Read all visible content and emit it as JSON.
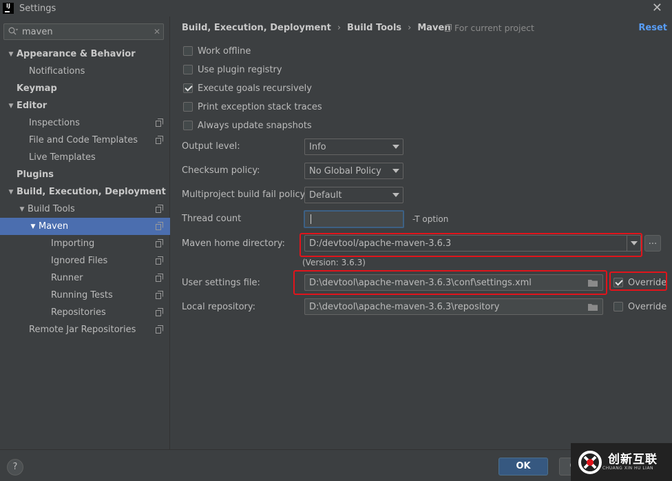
{
  "window": {
    "title": "Settings",
    "close_glyph": "✕",
    "app_icon": "intellij-logo-icon"
  },
  "search": {
    "value": "maven",
    "icon": "search-icon",
    "clear_glyph": "✕"
  },
  "tree": [
    {
      "label": "Appearance & Behavior",
      "level": 0,
      "bold": true,
      "arrow": "▼",
      "proj": false
    },
    {
      "label": "Notifications",
      "level": 1,
      "bold": false,
      "arrow": "",
      "proj": false
    },
    {
      "label": "Keymap",
      "level": 0,
      "bold": true,
      "arrow": "",
      "proj": false
    },
    {
      "label": "Editor",
      "level": 0,
      "bold": true,
      "arrow": "▼",
      "proj": false
    },
    {
      "label": "Inspections",
      "level": 1,
      "bold": false,
      "arrow": "",
      "proj": true
    },
    {
      "label": "File and Code Templates",
      "level": 1,
      "bold": false,
      "arrow": "",
      "proj": true
    },
    {
      "label": "Live Templates",
      "level": 1,
      "bold": false,
      "arrow": "",
      "proj": false
    },
    {
      "label": "Plugins",
      "level": 0,
      "bold": true,
      "arrow": "",
      "proj": false
    },
    {
      "label": "Build, Execution, Deployment",
      "level": 0,
      "bold": true,
      "arrow": "▼",
      "proj": false
    },
    {
      "label": "Build Tools",
      "level": 1,
      "bold": false,
      "arrow": "▼",
      "proj": true
    },
    {
      "label": "Maven",
      "level": 2,
      "bold": false,
      "arrow": "▼",
      "proj": true,
      "selected": true
    },
    {
      "label": "Importing",
      "level": 3,
      "bold": false,
      "arrow": "",
      "proj": true
    },
    {
      "label": "Ignored Files",
      "level": 3,
      "bold": false,
      "arrow": "",
      "proj": true
    },
    {
      "label": "Runner",
      "level": 3,
      "bold": false,
      "arrow": "",
      "proj": true
    },
    {
      "label": "Running Tests",
      "level": 3,
      "bold": false,
      "arrow": "",
      "proj": true
    },
    {
      "label": "Repositories",
      "level": 3,
      "bold": false,
      "arrow": "",
      "proj": true
    },
    {
      "label": "Remote Jar Repositories",
      "level": 1,
      "bold": false,
      "arrow": "",
      "proj": true
    }
  ],
  "breadcrumb": {
    "part1": "Build, Execution, Deployment",
    "part2": "Build Tools",
    "part3": "Maven",
    "sep": "›"
  },
  "scope": {
    "label": "For current project"
  },
  "reset": {
    "label": "Reset"
  },
  "checkboxes": {
    "work_offline": {
      "label": "Work offline",
      "checked": false
    },
    "plugin_registry": {
      "label": "Use plugin registry",
      "checked": false
    },
    "execute_goals": {
      "label": "Execute goals recursively",
      "checked": true
    },
    "print_exception": {
      "label": "Print exception stack traces",
      "checked": false
    },
    "always_update": {
      "label": "Always update snapshots",
      "checked": false
    }
  },
  "form": {
    "output_level": {
      "label": "Output level:",
      "value": "Info"
    },
    "checksum": {
      "label": "Checksum policy:",
      "value": "No Global Policy"
    },
    "multiproject": {
      "label": "Multiproject build fail policy:",
      "value": "Default"
    },
    "thread_count": {
      "label": "Thread count",
      "value": "",
      "hint": "-T option"
    },
    "maven_home": {
      "label": "Maven home directory:",
      "value": "D:/devtool/apache-maven-3.6.3",
      "version": "(Version: 3.6.3)",
      "browse": "..."
    },
    "user_settings": {
      "label": "User settings file:",
      "value": "D:\\devtool\\apache-maven-3.6.3\\conf\\settings.xml",
      "override_label": "Override",
      "override": true
    },
    "local_repo": {
      "label": "Local repository:",
      "value": "D:\\devtool\\apache-maven-3.6.3\\repository",
      "override_label": "Override",
      "override": false
    }
  },
  "footer": {
    "help": "?",
    "ok": "OK",
    "cancel": "C"
  },
  "watermark": {
    "text": "创新互联",
    "sub": "CHUANG XIN HU LIAN"
  },
  "colors": {
    "accent": "#4b6eaf",
    "link": "#589df6",
    "highlight": "#e1141b",
    "ok": "#365880"
  }
}
